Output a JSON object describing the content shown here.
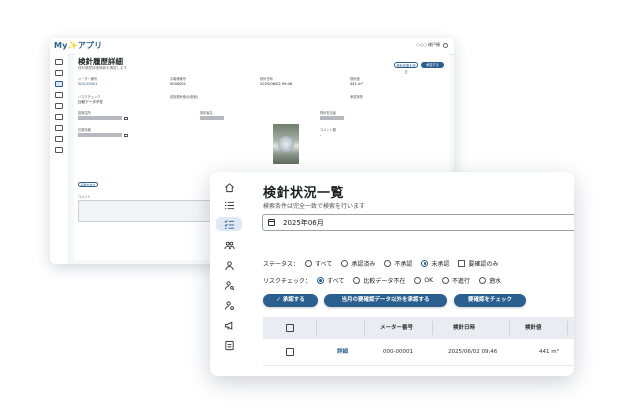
{
  "back": {
    "app_name": "My✨アプリ",
    "user": "○○○ 様戸棟",
    "title": "検針履歴詳細",
    "subtitle": "検針履歴詳細情報を確認します",
    "btn_outline": "検針結果を修正",
    "btn_filled": "承認する",
    "fields": {
      "meter_no_label": "メーター番号",
      "meter_no": "000-00001",
      "customer_label": "お客様番号",
      "customer": "0000001",
      "date_label": "検針日時",
      "date": "2025/06/02 09:46",
      "reading_label": "検針値",
      "reading": "441 m³",
      "risk_label": "リスクチェック",
      "risk": "比較データ不在",
      "prev_label": "前回検針値(比較値)",
      "status_label": "承認状態",
      "addr_label": "設置住所",
      "name_label": "契約者名",
      "photo_label": "検針担当者",
      "gps_label": "位置情報",
      "memo_label": "コメント欄",
      "memo_val": "-"
    },
    "small_btn": "画像を拡大",
    "comment_label": "コメント"
  },
  "front": {
    "title": "検針状況一覧",
    "subtitle": "検索条件は完全一致で検索を行います",
    "month": "2025年06月",
    "status_label": "ステータス：",
    "status_options": [
      "すべて",
      "承認済み",
      "不承認",
      "未承認"
    ],
    "status_check": "要確認のみ",
    "risk_label": "リスクチェック：",
    "risk_options": [
      "すべて",
      "比較データ不在",
      "OK",
      "不進行",
      "遡水"
    ],
    "btn_approve": "承認する",
    "btn_approve_month": "当月の要確認データ以外を承認する",
    "btn_check": "要確認をチェック",
    "table": {
      "headers": [
        "メーター番号",
        "検針日時",
        "検針値"
      ],
      "rows": [
        {
          "link": "詳細",
          "meter": "000-00001",
          "date": "2025/06/02 09:46",
          "value": "441 m³"
        }
      ]
    }
  }
}
